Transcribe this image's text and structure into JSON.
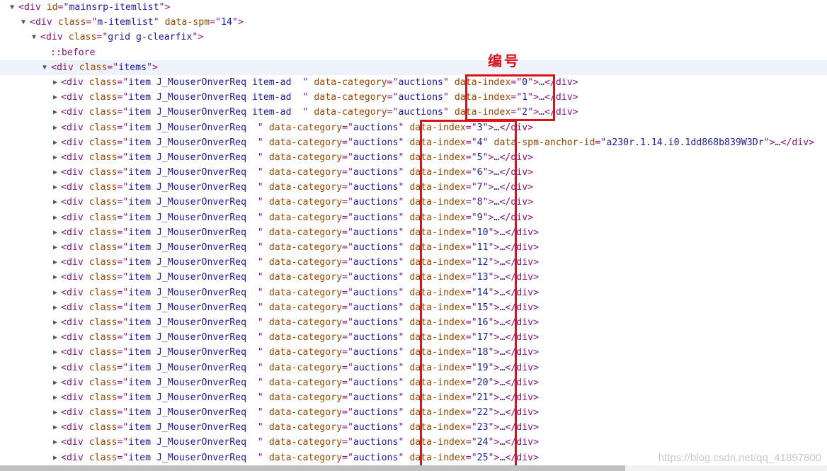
{
  "header_rows": [
    {
      "indent": 1,
      "expanded": true,
      "tag": "div",
      "attrs": [
        {
          "name": "id",
          "value": "mainsrp-itemlist"
        }
      ],
      "closing": ">"
    },
    {
      "indent": 2,
      "expanded": true,
      "tag": "div",
      "attrs": [
        {
          "name": "class",
          "value": "m-itemlist"
        },
        {
          "name": "data-spm",
          "value": "14"
        }
      ],
      "closing": ">"
    },
    {
      "indent": 3,
      "expanded": true,
      "tag": "div",
      "attrs": [
        {
          "name": "class",
          "value": "grid g-clearfix"
        }
      ],
      "closing": ">"
    }
  ],
  "pseudo": "::before",
  "items_row": {
    "tag": "div",
    "class_value": "items"
  },
  "item_rows": [
    {
      "class_value": "item J_MouserOnverReq item-ad  ",
      "category": "auctions",
      "index": "0",
      "extra": ""
    },
    {
      "class_value": "item J_MouserOnverReq item-ad  ",
      "category": "auctions",
      "index": "1",
      "extra": ""
    },
    {
      "class_value": "item J_MouserOnverReq item-ad  ",
      "category": "auctions",
      "index": "2",
      "extra": ""
    },
    {
      "class_value": "item J_MouserOnverReq  ",
      "category": "auctions",
      "index": "3",
      "extra": ""
    },
    {
      "class_value": "item J_MouserOnverReq  ",
      "category": "auctions",
      "index": "4",
      "extra": "a230r.1.14.i0.1dd868b839W3Dr"
    },
    {
      "class_value": "item J_MouserOnverReq  ",
      "category": "auctions",
      "index": "5",
      "extra": ""
    },
    {
      "class_value": "item J_MouserOnverReq  ",
      "category": "auctions",
      "index": "6",
      "extra": ""
    },
    {
      "class_value": "item J_MouserOnverReq  ",
      "category": "auctions",
      "index": "7",
      "extra": ""
    },
    {
      "class_value": "item J_MouserOnverReq  ",
      "category": "auctions",
      "index": "8",
      "extra": ""
    },
    {
      "class_value": "item J_MouserOnverReq  ",
      "category": "auctions",
      "index": "9",
      "extra": ""
    },
    {
      "class_value": "item J_MouserOnverReq  ",
      "category": "auctions",
      "index": "10",
      "extra": ""
    },
    {
      "class_value": "item J_MouserOnverReq  ",
      "category": "auctions",
      "index": "11",
      "extra": ""
    },
    {
      "class_value": "item J_MouserOnverReq  ",
      "category": "auctions",
      "index": "12",
      "extra": ""
    },
    {
      "class_value": "item J_MouserOnverReq  ",
      "category": "auctions",
      "index": "13",
      "extra": ""
    },
    {
      "class_value": "item J_MouserOnverReq  ",
      "category": "auctions",
      "index": "14",
      "extra": ""
    },
    {
      "class_value": "item J_MouserOnverReq  ",
      "category": "auctions",
      "index": "15",
      "extra": ""
    },
    {
      "class_value": "item J_MouserOnverReq  ",
      "category": "auctions",
      "index": "16",
      "extra": ""
    },
    {
      "class_value": "item J_MouserOnverReq  ",
      "category": "auctions",
      "index": "17",
      "extra": ""
    },
    {
      "class_value": "item J_MouserOnverReq  ",
      "category": "auctions",
      "index": "18",
      "extra": ""
    },
    {
      "class_value": "item J_MouserOnverReq  ",
      "category": "auctions",
      "index": "19",
      "extra": ""
    },
    {
      "class_value": "item J_MouserOnverReq  ",
      "category": "auctions",
      "index": "20",
      "extra": ""
    },
    {
      "class_value": "item J_MouserOnverReq  ",
      "category": "auctions",
      "index": "21",
      "extra": ""
    },
    {
      "class_value": "item J_MouserOnverReq  ",
      "category": "auctions",
      "index": "22",
      "extra": ""
    },
    {
      "class_value": "item J_MouserOnverReq  ",
      "category": "auctions",
      "index": "23",
      "extra": ""
    },
    {
      "class_value": "item J_MouserOnverReq  ",
      "category": "auctions",
      "index": "24",
      "extra": ""
    },
    {
      "class_value": "item J_MouserOnverReq  ",
      "category": "auctions",
      "index": "25",
      "extra": ""
    }
  ],
  "labels": {
    "attr_class": "class",
    "attr_category": "data-category",
    "attr_index": "data-index",
    "attr_anchor": "data-spm-anchor-id",
    "ellipsis": "…",
    "close_tag": "</div>",
    "expand_icon": "triangle-right-icon",
    "collapse_icon": "triangle-down-icon"
  },
  "annotation": "编号",
  "watermark": "https://blog.csdn.net/qq_41897800",
  "colors": {
    "tag": "#881280",
    "attr_name": "#994500",
    "attr_value": "#1a1aa6",
    "highlight_box": "#e0101a",
    "selected_row": "#eef3fb"
  }
}
